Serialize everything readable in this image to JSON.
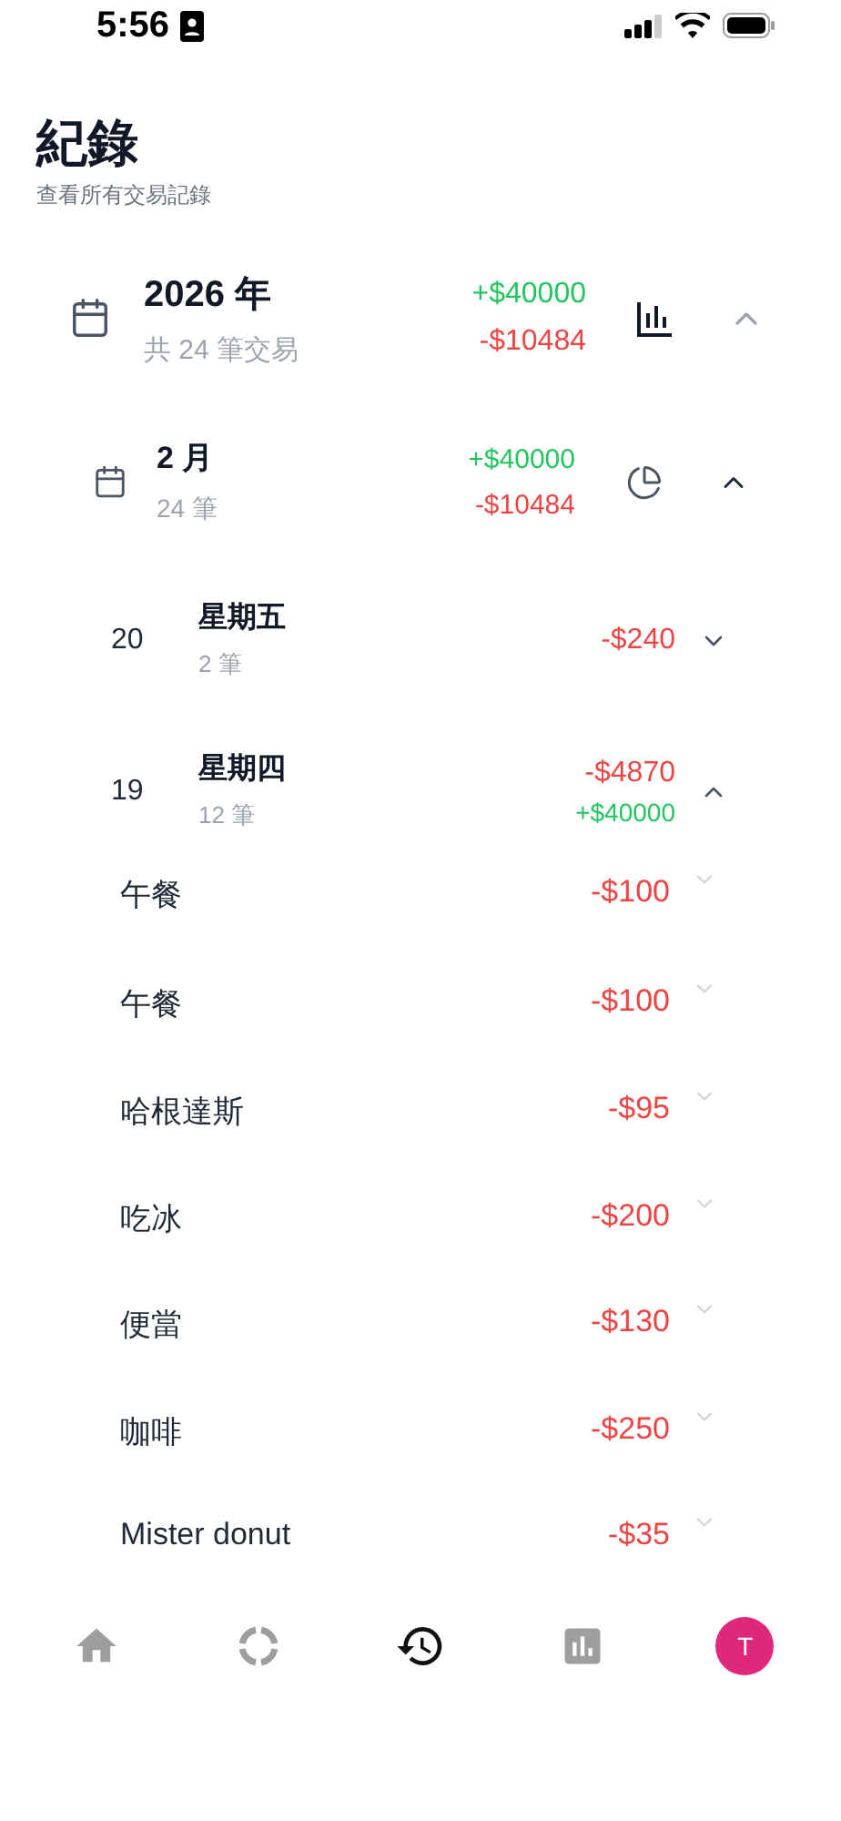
{
  "status_bar": {
    "time": "5:56"
  },
  "header": {
    "title": "紀錄",
    "subtitle": "查看所有交易記錄"
  },
  "year": {
    "title": "2026 年",
    "count": "共 24 筆交易",
    "income": "+$40000",
    "expense": "-$10484",
    "expanded": true
  },
  "month": {
    "title": "2 月",
    "count": "24 筆",
    "income": "+$40000",
    "expense": "-$10484",
    "expanded": true
  },
  "days": [
    {
      "day": "20",
      "weekday": "星期五",
      "count": "2 筆",
      "amounts": [
        {
          "text": "-$240",
          "kind": "expense"
        }
      ],
      "expanded": false
    },
    {
      "day": "19",
      "weekday": "星期四",
      "count": "12 筆",
      "amounts": [
        {
          "text": "-$4870",
          "kind": "expense"
        },
        {
          "text": "+$40000",
          "kind": "income"
        }
      ],
      "expanded": true,
      "items": [
        {
          "name": "午餐",
          "amount": "-$100",
          "kind": "expense"
        },
        {
          "name": "午餐",
          "amount": "-$100",
          "kind": "expense"
        },
        {
          "name": "哈根達斯",
          "amount": "-$95",
          "kind": "expense"
        },
        {
          "name": "吃冰",
          "amount": "-$200",
          "kind": "expense"
        },
        {
          "name": "便當",
          "amount": "-$130",
          "kind": "expense"
        },
        {
          "name": "咖啡",
          "amount": "-$250",
          "kind": "expense"
        },
        {
          "name": "Mister donut",
          "amount": "-$35",
          "kind": "expense"
        }
      ]
    }
  ],
  "nav": [
    {
      "kind": "home",
      "selected": false
    },
    {
      "kind": "progress",
      "selected": false
    },
    {
      "kind": "history",
      "selected": true
    },
    {
      "kind": "chart",
      "selected": false
    },
    {
      "kind": "avatar",
      "label": "T",
      "selected": false
    }
  ]
}
